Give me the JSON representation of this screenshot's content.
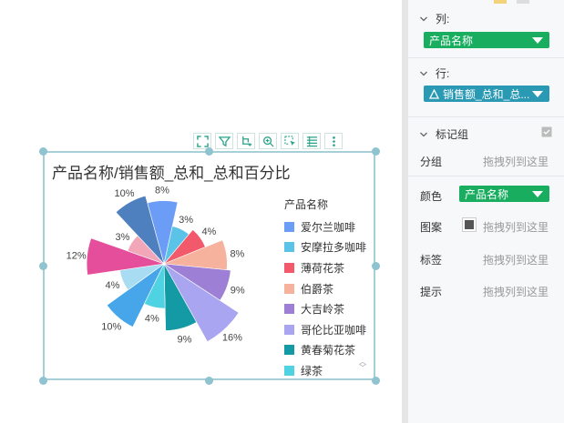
{
  "widget": {
    "title": "产品名称/销售额_总和_总和百分比",
    "toolbar": [
      {
        "name": "fullscreen-icon"
      },
      {
        "name": "filter-icon"
      },
      {
        "name": "drill-icon"
      },
      {
        "name": "zoom-icon"
      },
      {
        "name": "select-icon"
      },
      {
        "name": "list-icon"
      },
      {
        "name": "more-icon"
      }
    ]
  },
  "chart_data": {
    "type": "pie",
    "subtype": "nightingale-rose",
    "title": "产品名称/销售额_总和_总和百分比",
    "legend_title": "产品名称",
    "legend_position": "right",
    "slices": [
      {
        "label": "爱尔兰咖啡",
        "value": 8,
        "text": "8%",
        "color": "#6b9cf6"
      },
      {
        "label": "安摩拉多咖啡",
        "value": 3,
        "text": "3%",
        "color": "#5bc3e8"
      },
      {
        "label": "薄荷花茶",
        "value": 4,
        "text": "4%",
        "color": "#f25a6b"
      },
      {
        "label": "伯爵茶",
        "value": 8,
        "text": "8%",
        "color": "#f7b29e"
      },
      {
        "label": "大吉岭茶",
        "value": 9,
        "text": "9%",
        "color": "#9d7fd6"
      },
      {
        "label": "哥伦比亚咖啡",
        "value": 16,
        "text": "16%",
        "color": "#a9a5f1"
      },
      {
        "label": "黄春菊花茶",
        "value": 9,
        "text": "9%",
        "color": "#149aa4"
      },
      {
        "label": "绿茶",
        "value": 4,
        "text": "4%",
        "color": "#4fd3e3"
      },
      {
        "label": "",
        "value": 10,
        "text": "10%",
        "color": "#47a6ea"
      },
      {
        "label": "",
        "value": 4,
        "text": "4%",
        "color": "#a8dcf2"
      },
      {
        "label": "",
        "value": 12,
        "text": "12%",
        "color": "#e54e9b"
      },
      {
        "label": "",
        "value": 3,
        "text": "3%",
        "color": "#f2a7b8"
      },
      {
        "label": "",
        "value": 10,
        "text": "10%",
        "color": "#4e7fbe"
      }
    ],
    "legend": [
      "爱尔兰咖啡",
      "安摩拉多咖啡",
      "薄荷花茶",
      "伯爵茶",
      "大吉岭茶",
      "哥伦比亚咖啡",
      "黄春菊花茶",
      "绿茶"
    ]
  },
  "panel": {
    "columns_label": "列:",
    "columns_field": "产品名称",
    "rows_label": "行:",
    "rows_field": "销售额_总和_总...",
    "marks_label": "标记组",
    "group_label": "分组",
    "group_hint": "拖拽列到这里",
    "color_label": "颜色",
    "color_field": "产品名称",
    "pattern_label": "图案",
    "pattern_hint": "拖拽列到这里",
    "tag_label": "标签",
    "tag_hint": "拖拽列到这里",
    "tip_label": "提示",
    "tip_hint": "拖拽列到这里"
  }
}
